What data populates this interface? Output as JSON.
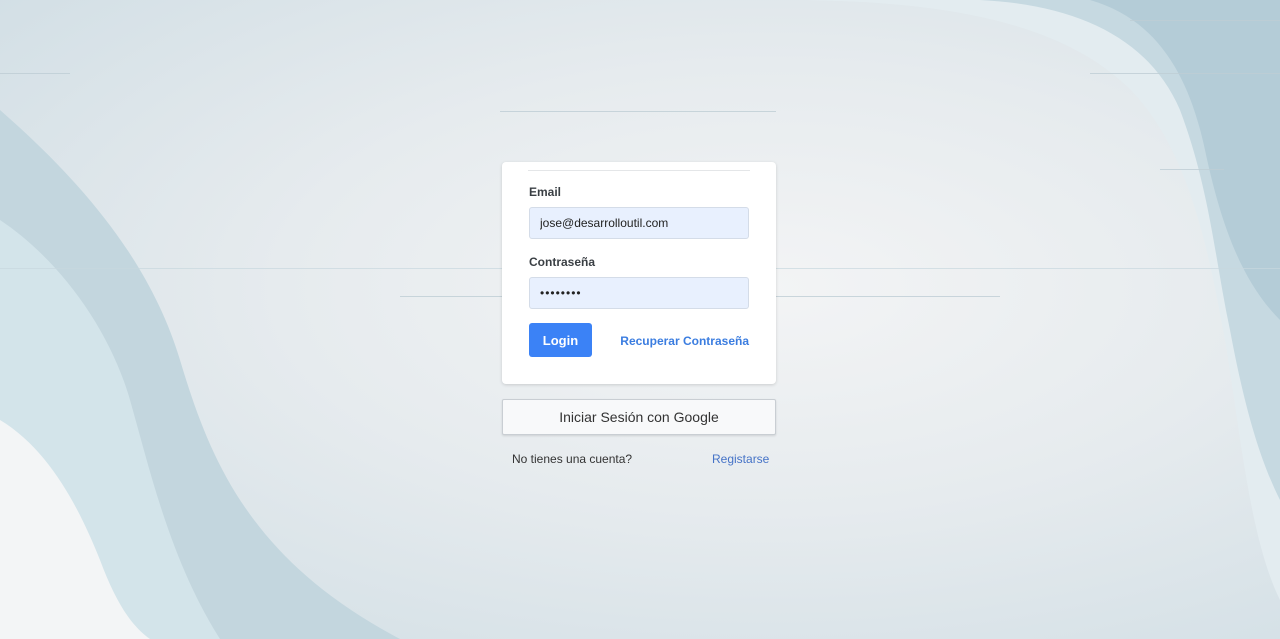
{
  "login_form": {
    "email_label": "Email",
    "email_value": "jose@desarrolloutil.com",
    "password_label": "Contraseña",
    "password_value": "••••••••",
    "login_button": "Login",
    "recover_link": "Recuperar Contraseña"
  },
  "google_button": "Iniciar Sesión con Google",
  "register": {
    "prompt": "No tienes una cuenta?",
    "link": "Registarse"
  },
  "colors": {
    "primary": "#3b82f6",
    "link": "#3b7de0",
    "input_bg": "#e8f0fe",
    "wave_light": "#d7e6ec",
    "wave_dark": "#b9cfd9"
  }
}
